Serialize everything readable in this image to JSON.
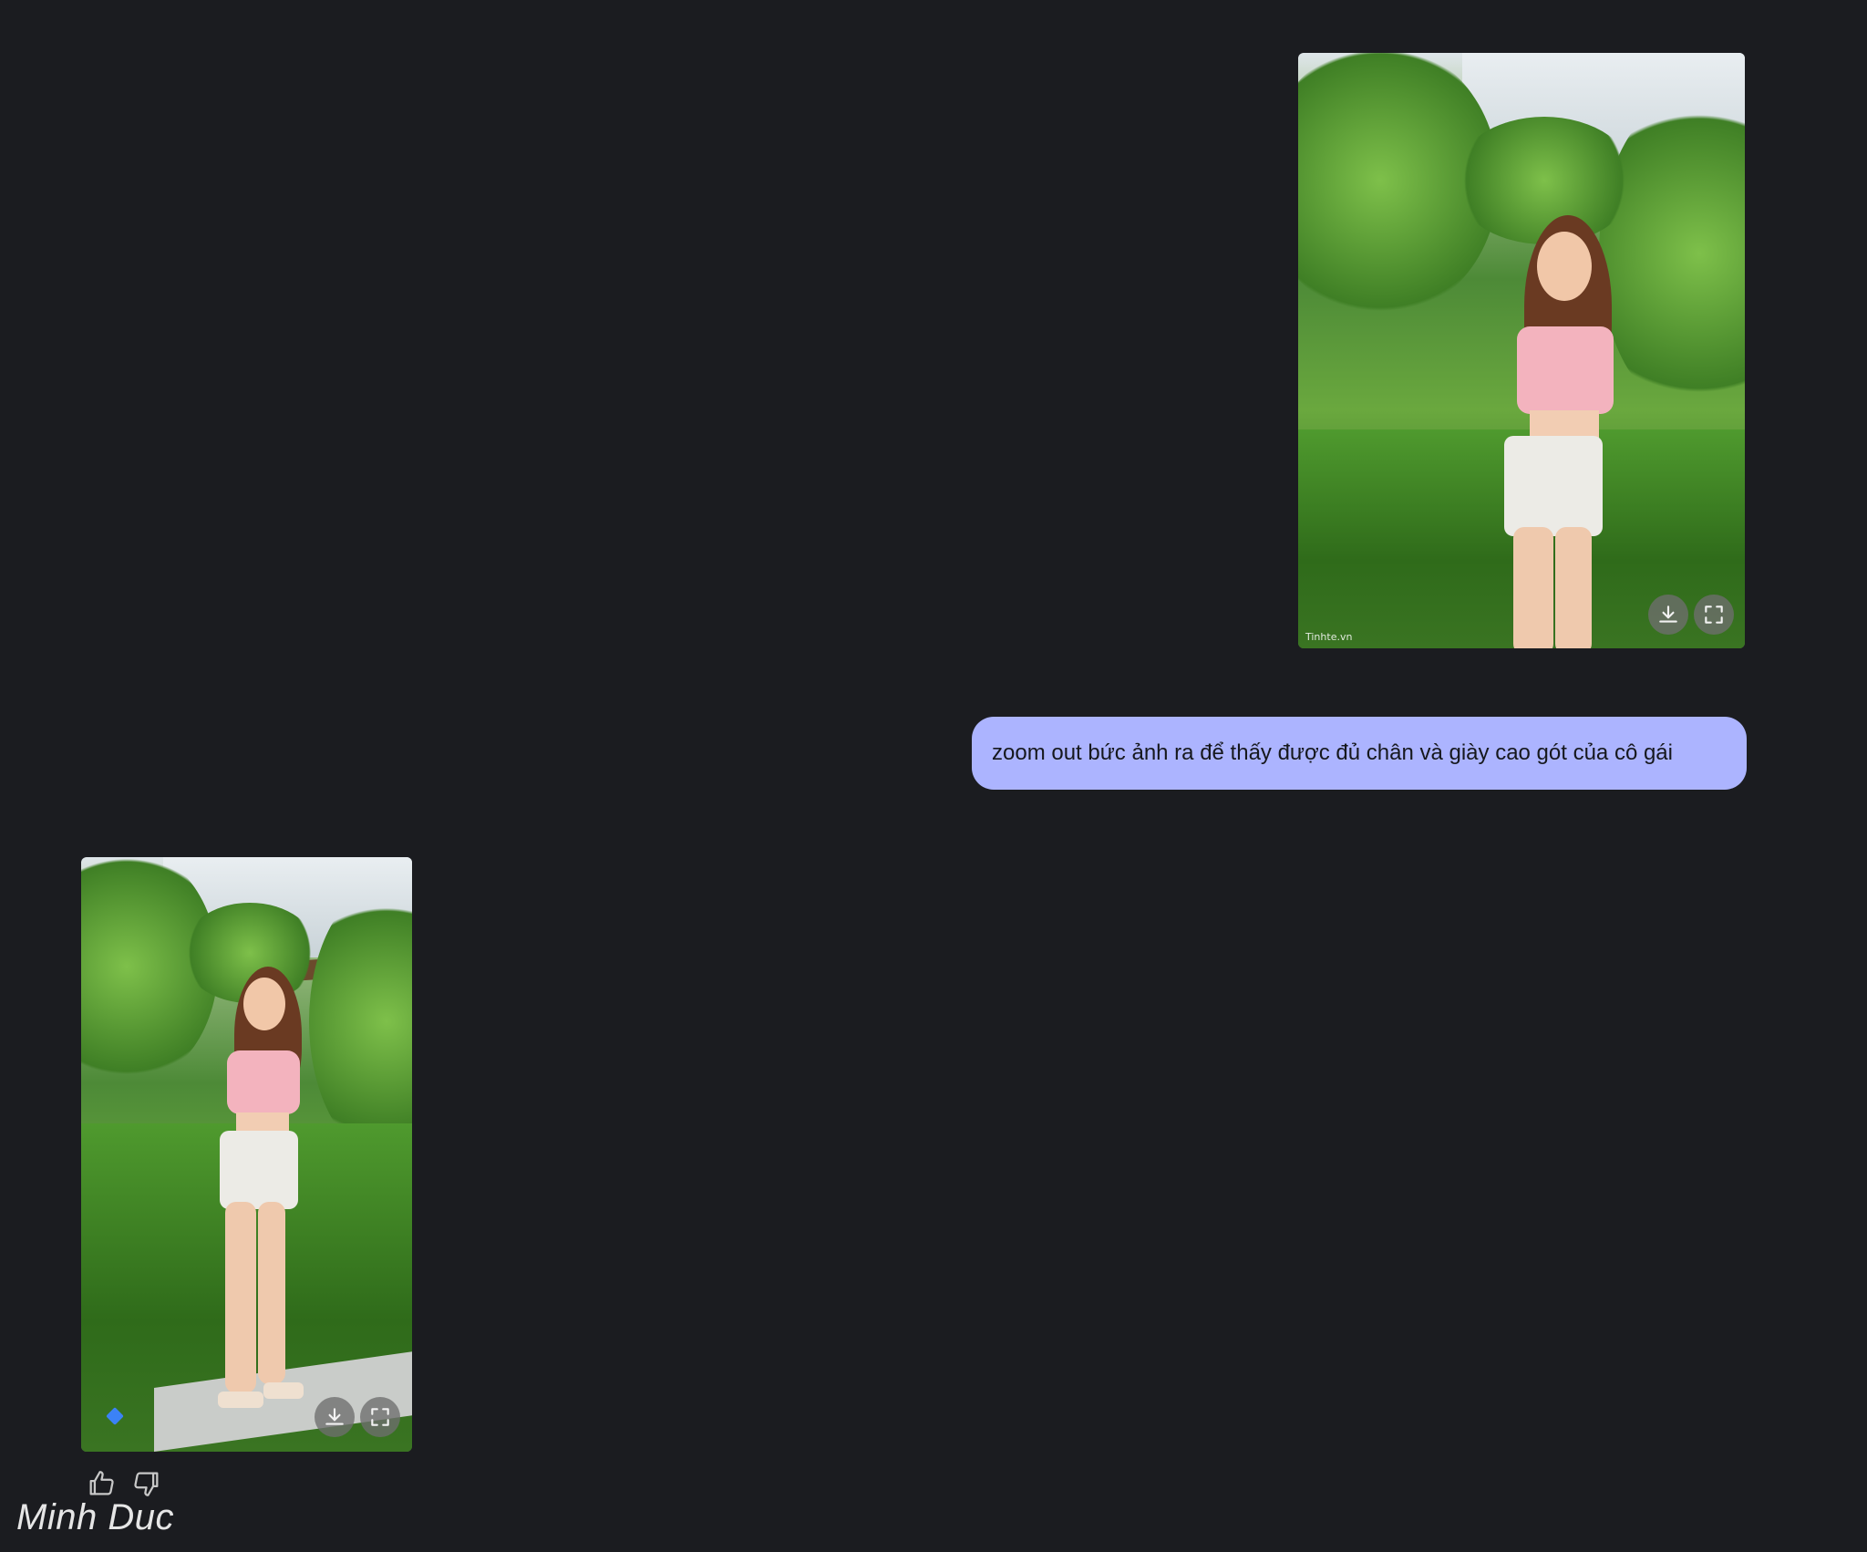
{
  "user_message": {
    "image_watermark": "Tinhte.vn",
    "text": "zoom out bức ảnh ra để thấy được đủ chân và giày cao gót của cô gái"
  },
  "image_actions": {
    "download_icon": "download-icon",
    "fullscreen_icon": "fullscreen-icon"
  },
  "response": {
    "feedback": {
      "like_icon": "thumbs-up-icon",
      "dislike_icon": "thumbs-down-icon"
    },
    "brand_icon": "gemini-spark-icon"
  },
  "signature": "Minh Duc",
  "colors": {
    "background": "#1b1c20",
    "user_bubble": "#acb4ff",
    "bubble_text": "#16181d"
  }
}
